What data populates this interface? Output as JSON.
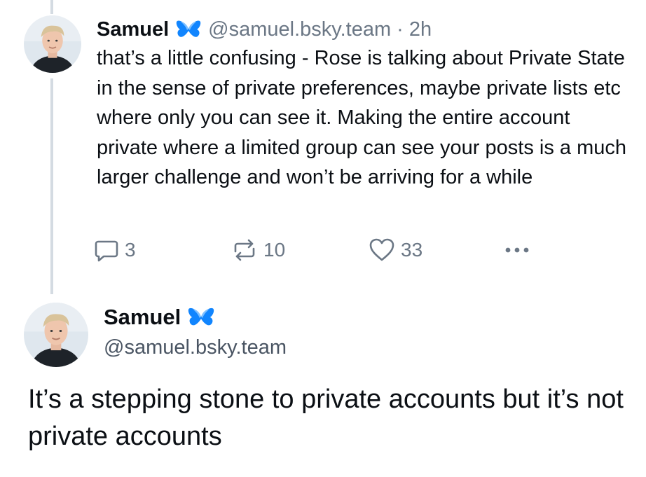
{
  "colors": {
    "text": "#0b0f14",
    "secondary": "#6b7785",
    "thread_line": "#d4dbe2",
    "verified_badge": "#1185fe"
  },
  "parent_post": {
    "author": {
      "display_name": "Samuel",
      "handle": "@samuel.bsky.team",
      "badge_icon": "butterfly-verified-icon"
    },
    "separator": "·",
    "time": "2h",
    "text": "that’s a little confusing - Rose is talking about Private State in the sense of private preferences, maybe private lists etc where only you can see it. Making the entire account private where a limited group can see your posts is a much larger challenge and won’t be arriving for a while",
    "actions": {
      "reply_icon": "reply-bubble-icon",
      "reply_count": "3",
      "repost_icon": "repost-icon",
      "repost_count": "10",
      "like_icon": "heart-icon",
      "like_count": "33",
      "more_icon": "more-dots-icon"
    }
  },
  "focused_post": {
    "author": {
      "display_name": "Samuel",
      "handle": "@samuel.bsky.team",
      "badge_icon": "butterfly-verified-icon"
    },
    "text": "It’s a stepping stone to private accounts but it’s not private accounts"
  }
}
